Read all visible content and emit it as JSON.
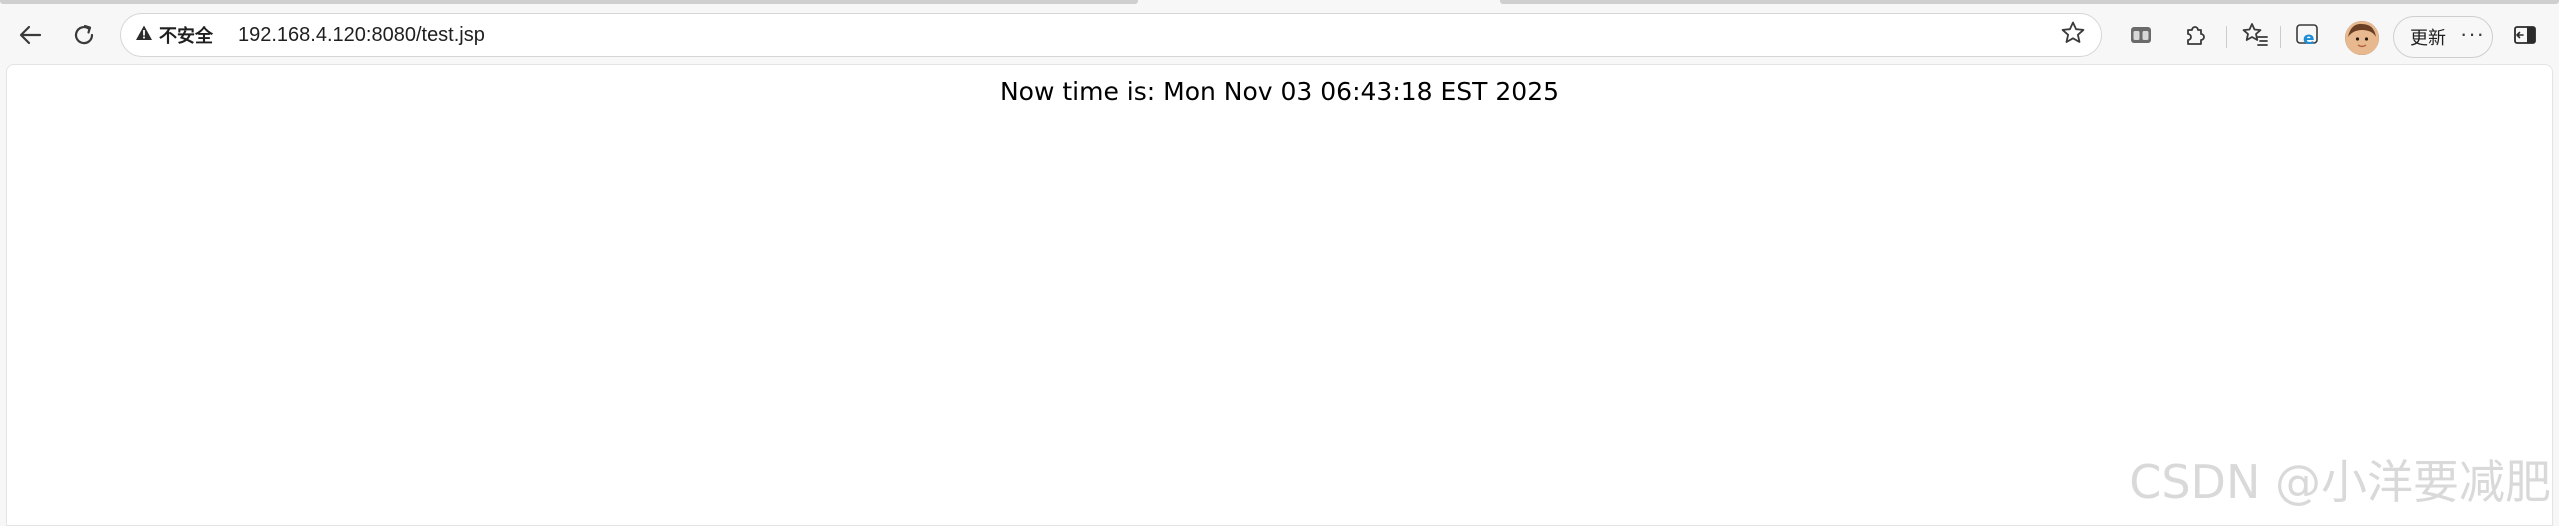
{
  "browser": {
    "address_bar": {
      "security_label": "不安全",
      "url": "192.168.4.120:8080/test.jsp"
    },
    "update_button_label": "更新",
    "more_label": "···"
  },
  "page": {
    "time_text": "Now time is: Mon Nov 03 06:43:18 EST 2025"
  },
  "watermark": "CSDN @小洋要减肥",
  "icons": {
    "back": "back-arrow-icon",
    "refresh": "refresh-icon",
    "warning": "warning-triangle-icon",
    "favorite": "star-icon",
    "collections": "split-screen-icon",
    "extensions": "puzzle-icon",
    "favorites_list": "favorites-icon",
    "ie_mode": "ie-mode-icon",
    "sidebar": "sidebar-icon"
  },
  "colors": {
    "ie_accent": "#1c8cd6",
    "watermark": "#d9d9d9"
  }
}
